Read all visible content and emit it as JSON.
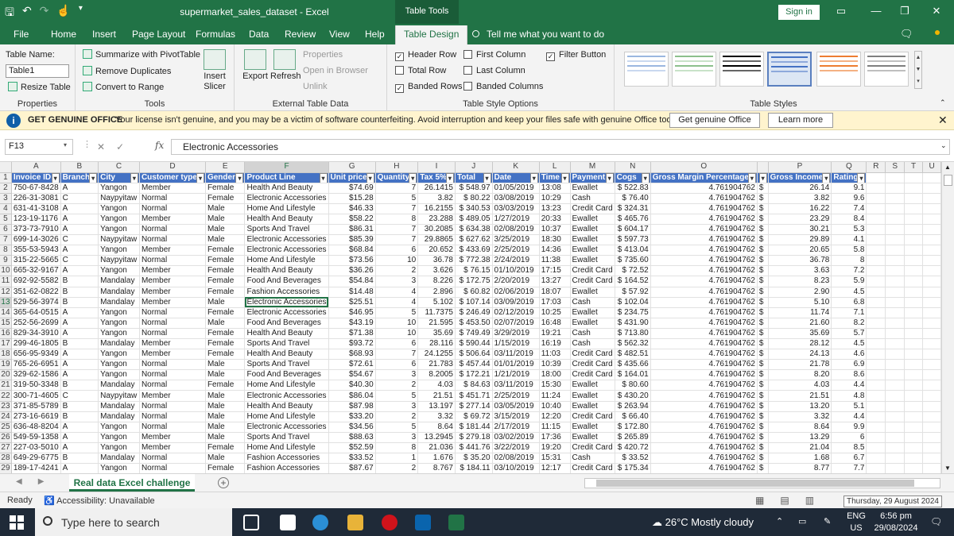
{
  "window": {
    "title": "supermarket_sales_dataset  -  Excel",
    "context_tab": "Table Tools",
    "sign_in": "Sign in"
  },
  "tabs": [
    "File",
    "Home",
    "Insert",
    "Page Layout",
    "Formulas",
    "Data",
    "Review",
    "View",
    "Help",
    "Table Design"
  ],
  "tell_me": "Tell me what you want to do",
  "ribbon": {
    "properties": {
      "table_name_label": "Table Name:",
      "table_name_value": "Table1",
      "resize": "Resize Table",
      "group": "Properties"
    },
    "tools": {
      "pivot": "Summarize with PivotTable",
      "dupes": "Remove Duplicates",
      "range": "Convert to Range",
      "slicer_l1": "Insert",
      "slicer_l2": "Slicer",
      "group": "Tools"
    },
    "external": {
      "export": "Export",
      "refresh": "Refresh",
      "props": "Properties",
      "open": "Open in Browser",
      "unlink": "Unlink",
      "group": "External Table Data"
    },
    "style_options": {
      "header_row": "Header Row",
      "total_row": "Total Row",
      "banded_rows": "Banded Rows",
      "first_col": "First Column",
      "last_col": "Last Column",
      "banded_cols": "Banded Columns",
      "filter_btn": "Filter Button",
      "group": "Table Style Options"
    },
    "styles": {
      "group": "Table Styles"
    }
  },
  "message": {
    "title": "GET GENUINE OFFICE",
    "text": "Your license isn't genuine, and you may be a victim of software counterfeiting. Avoid interruption and keep your files safe with genuine Office today.",
    "btn1": "Get genuine Office",
    "btn2": "Learn more"
  },
  "formula_bar": {
    "name_box": "F13",
    "formula": "Electronic Accessories",
    "fx": "fx"
  },
  "columns": [
    "A",
    "B",
    "C",
    "D",
    "E",
    "F",
    "G",
    "H",
    "I",
    "J",
    "K",
    "L",
    "M",
    "N",
    "O",
    "P",
    "Q",
    "R",
    "S",
    "T",
    "U"
  ],
  "headers": [
    "Invoice ID",
    "Branch",
    "City",
    "Customer type",
    "Gender",
    "Product Line",
    "Unit price",
    "Quantity",
    "Tax 5%",
    "Total",
    "Date",
    "Time",
    "Payment",
    "Cogs",
    "Gross Margin Percentage",
    "Gross Income",
    "Rating"
  ],
  "rows": [
    [
      "750-67-8428",
      "A",
      "Yangon",
      "Member",
      "Female",
      "Health And Beauty",
      "$74.69",
      "7",
      "26.1415",
      "$  548.97",
      "01/05/2019",
      "13:08",
      "Ewallet",
      "$ 522.83",
      "4.761904762",
      "$",
      "26.14",
      "9.1"
    ],
    [
      "226-31-3081",
      "C",
      "Naypyitaw",
      "Normal",
      "Female",
      "Electronic Accessories",
      "$15.28",
      "5",
      "3.82",
      "$    80.22",
      "03/08/2019",
      "10:29",
      "Cash",
      "$  76.40",
      "4.761904762",
      "$",
      "3.82",
      "9.6"
    ],
    [
      "631-41-3108",
      "A",
      "Yangon",
      "Normal",
      "Male",
      "Home And Lifestyle",
      "$46.33",
      "7",
      "16.2155",
      "$  340.53",
      "03/03/2019",
      "13:23",
      "Credit Card",
      "$ 324.31",
      "4.761904762",
      "$",
      "16.22",
      "7.4"
    ],
    [
      "123-19-1176",
      "A",
      "Yangon",
      "Member",
      "Male",
      "Health And Beauty",
      "$58.22",
      "8",
      "23.288",
      "$  489.05",
      "1/27/2019",
      "20:33",
      "Ewallet",
      "$ 465.76",
      "4.761904762",
      "$",
      "23.29",
      "8.4"
    ],
    [
      "373-73-7910",
      "A",
      "Yangon",
      "Normal",
      "Male",
      "Sports And Travel",
      "$86.31",
      "7",
      "30.2085",
      "$  634.38",
      "02/08/2019",
      "10:37",
      "Ewallet",
      "$ 604.17",
      "4.761904762",
      "$",
      "30.21",
      "5.3"
    ],
    [
      "699-14-3026",
      "C",
      "Naypyitaw",
      "Normal",
      "Male",
      "Electronic Accessories",
      "$85.39",
      "7",
      "29.8865",
      "$  627.62",
      "3/25/2019",
      "18:30",
      "Ewallet",
      "$ 597.73",
      "4.761904762",
      "$",
      "29.89",
      "4.1"
    ],
    [
      "355-53-5943",
      "A",
      "Yangon",
      "Member",
      "Female",
      "Electronic Accessories",
      "$68.84",
      "6",
      "20.652",
      "$  433.69",
      "2/25/2019",
      "14:36",
      "Ewallet",
      "$ 413.04",
      "4.761904762",
      "$",
      "20.65",
      "5.8"
    ],
    [
      "315-22-5665",
      "C",
      "Naypyitaw",
      "Normal",
      "Female",
      "Home And Lifestyle",
      "$73.56",
      "10",
      "36.78",
      "$  772.38",
      "2/24/2019",
      "11:38",
      "Ewallet",
      "$ 735.60",
      "4.761904762",
      "$",
      "36.78",
      "8"
    ],
    [
      "665-32-9167",
      "A",
      "Yangon",
      "Member",
      "Female",
      "Health And Beauty",
      "$36.26",
      "2",
      "3.626",
      "$    76.15",
      "01/10/2019",
      "17:15",
      "Credit Card",
      "$  72.52",
      "4.761904762",
      "$",
      "3.63",
      "7.2"
    ],
    [
      "692-92-5582",
      "B",
      "Mandalay",
      "Member",
      "Female",
      "Food And Beverages",
      "$54.84",
      "3",
      "8.226",
      "$  172.75",
      "2/20/2019",
      "13:27",
      "Credit Card",
      "$ 164.52",
      "4.761904762",
      "$",
      "8.23",
      "5.9"
    ],
    [
      "351-62-0822",
      "B",
      "Mandalay",
      "Member",
      "Female",
      "Fashion Accessories",
      "$14.48",
      "4",
      "2.896",
      "$    60.82",
      "02/06/2019",
      "18:07",
      "Ewallet",
      "$  57.92",
      "4.761904762",
      "$",
      "2.90",
      "4.5"
    ],
    [
      "529-56-3974",
      "B",
      "Mandalay",
      "Member",
      "Male",
      "Electronic Accessories",
      "$25.51",
      "4",
      "5.102",
      "$  107.14",
      "03/09/2019",
      "17:03",
      "Cash",
      "$ 102.04",
      "4.761904762",
      "$",
      "5.10",
      "6.8"
    ],
    [
      "365-64-0515",
      "A",
      "Yangon",
      "Normal",
      "Female",
      "Electronic Accessories",
      "$46.95",
      "5",
      "11.7375",
      "$  246.49",
      "02/12/2019",
      "10:25",
      "Ewallet",
      "$ 234.75",
      "4.761904762",
      "$",
      "11.74",
      "7.1"
    ],
    [
      "252-56-2699",
      "A",
      "Yangon",
      "Normal",
      "Male",
      "Food And Beverages",
      "$43.19",
      "10",
      "21.595",
      "$  453.50",
      "02/07/2019",
      "16:48",
      "Ewallet",
      "$ 431.90",
      "4.761904762",
      "$",
      "21.60",
      "8.2"
    ],
    [
      "829-34-3910",
      "A",
      "Yangon",
      "Normal",
      "Female",
      "Health And Beauty",
      "$71.38",
      "10",
      "35.69",
      "$  749.49",
      "3/29/2019",
      "19:21",
      "Cash",
      "$ 713.80",
      "4.761904762",
      "$",
      "35.69",
      "5.7"
    ],
    [
      "299-46-1805",
      "B",
      "Mandalay",
      "Member",
      "Female",
      "Sports And Travel",
      "$93.72",
      "6",
      "28.116",
      "$  590.44",
      "1/15/2019",
      "16:19",
      "Cash",
      "$ 562.32",
      "4.761904762",
      "$",
      "28.12",
      "4.5"
    ],
    [
      "656-95-9349",
      "A",
      "Yangon",
      "Member",
      "Female",
      "Health And Beauty",
      "$68.93",
      "7",
      "24.1255",
      "$  506.64",
      "03/11/2019",
      "11:03",
      "Credit Card",
      "$ 482.51",
      "4.761904762",
      "$",
      "24.13",
      "4.6"
    ],
    [
      "765-26-6951",
      "A",
      "Yangon",
      "Normal",
      "Male",
      "Sports And Travel",
      "$72.61",
      "6",
      "21.783",
      "$  457.44",
      "01/01/2019",
      "10:39",
      "Credit Card",
      "$ 435.66",
      "4.761904762",
      "$",
      "21.78",
      "6.9"
    ],
    [
      "329-62-1586",
      "A",
      "Yangon",
      "Normal",
      "Male",
      "Food And Beverages",
      "$54.67",
      "3",
      "8.2005",
      "$  172.21",
      "1/21/2019",
      "18:00",
      "Credit Card",
      "$ 164.01",
      "4.761904762",
      "$",
      "8.20",
      "8.6"
    ],
    [
      "319-50-3348",
      "B",
      "Mandalay",
      "Normal",
      "Female",
      "Home And Lifestyle",
      "$40.30",
      "2",
      "4.03",
      "$    84.63",
      "03/11/2019",
      "15:30",
      "Ewallet",
      "$  80.60",
      "4.761904762",
      "$",
      "4.03",
      "4.4"
    ],
    [
      "300-71-4605",
      "C",
      "Naypyitaw",
      "Member",
      "Male",
      "Electronic Accessories",
      "$86.04",
      "5",
      "21.51",
      "$  451.71",
      "2/25/2019",
      "11:24",
      "Ewallet",
      "$ 430.20",
      "4.761904762",
      "$",
      "21.51",
      "4.8"
    ],
    [
      "371-85-5789",
      "B",
      "Mandalay",
      "Normal",
      "Male",
      "Health And Beauty",
      "$87.98",
      "3",
      "13.197",
      "$  277.14",
      "03/05/2019",
      "10:40",
      "Ewallet",
      "$ 263.94",
      "4.761904762",
      "$",
      "13.20",
      "5.1"
    ],
    [
      "273-16-6619",
      "B",
      "Mandalay",
      "Normal",
      "Male",
      "Home And Lifestyle",
      "$33.20",
      "2",
      "3.32",
      "$    69.72",
      "3/15/2019",
      "12:20",
      "Credit Card",
      "$  66.40",
      "4.761904762",
      "$",
      "3.32",
      "4.4"
    ],
    [
      "636-48-8204",
      "A",
      "Yangon",
      "Normal",
      "Male",
      "Electronic Accessories",
      "$34.56",
      "5",
      "8.64",
      "$  181.44",
      "2/17/2019",
      "11:15",
      "Ewallet",
      "$ 172.80",
      "4.761904762",
      "$",
      "8.64",
      "9.9"
    ],
    [
      "549-59-1358",
      "A",
      "Yangon",
      "Member",
      "Male",
      "Sports And Travel",
      "$88.63",
      "3",
      "13.2945",
      "$  279.18",
      "03/02/2019",
      "17:36",
      "Ewallet",
      "$ 265.89",
      "4.761904762",
      "$",
      "13.29",
      "6"
    ],
    [
      "227-03-5010",
      "A",
      "Yangon",
      "Member",
      "Female",
      "Home And Lifestyle",
      "$52.59",
      "8",
      "21.036",
      "$  441.76",
      "3/22/2019",
      "19:20",
      "Credit Card",
      "$ 420.72",
      "4.761904762",
      "$",
      "21.04",
      "8.5"
    ],
    [
      "649-29-6775",
      "B",
      "Mandalay",
      "Normal",
      "Male",
      "Fashion Accessories",
      "$33.52",
      "1",
      "1.676",
      "$    35.20",
      "02/08/2019",
      "15:31",
      "Cash",
      "$  33.52",
      "4.761904762",
      "$",
      "1.68",
      "6.7"
    ],
    [
      "189-17-4241",
      "A",
      "Yangon",
      "Normal",
      "Female",
      "Fashion Accessories",
      "$87.67",
      "2",
      "8.767",
      "$  184.11",
      "03/10/2019",
      "12:17",
      "Credit Card",
      "$ 175.34",
      "4.761904762",
      "$",
      "8.77",
      "7.7"
    ]
  ],
  "sheet_tab": "Real data Excel challenge",
  "status": {
    "ready": "Ready",
    "accessibility": "Accessibility: Unavailable",
    "tooltip": "Thursday, 29 August 2024"
  },
  "taskbar": {
    "search": "Type here to search",
    "weather": "26°C  Mostly cloudy",
    "lang1": "ENG",
    "lang2": "US",
    "time": "6:56 pm",
    "date": "29/08/2024"
  }
}
